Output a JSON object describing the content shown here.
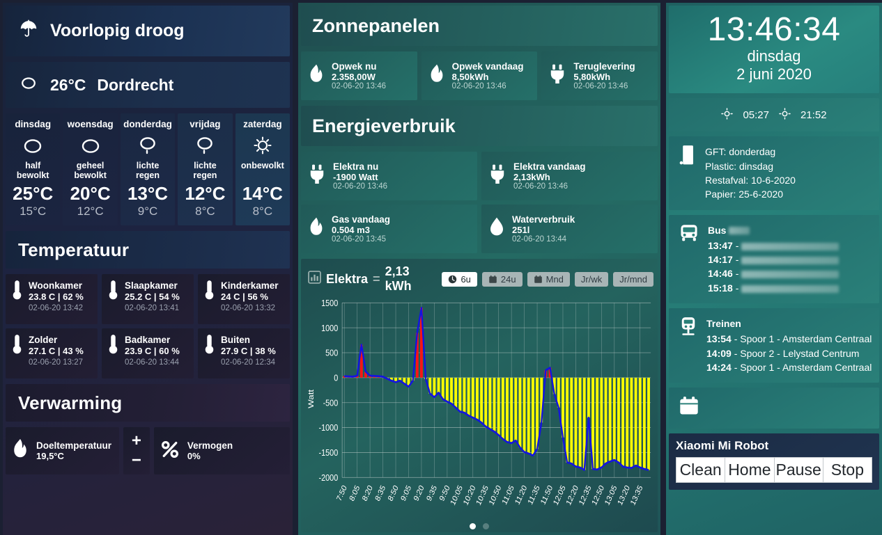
{
  "weather": {
    "forecast_summary": "Voorlopig droog",
    "current_temp": "26°C",
    "location": "Dordrecht",
    "summary_icon": "umbrella-icon",
    "current_icon": "cloud-icon",
    "days": [
      {
        "name": "dinsdag",
        "icon": "cloud-icon",
        "desc": "half\nbewolkt",
        "high": "25°C",
        "low": "15°C"
      },
      {
        "name": "woensdag",
        "icon": "cloud-icon",
        "desc": "geheel\nbewolkt",
        "high": "20°C",
        "low": "12°C"
      },
      {
        "name": "donderdag",
        "icon": "rain-icon",
        "desc": "lichte\nregen",
        "high": "13°C",
        "low": "9°C"
      },
      {
        "name": "vrijdag",
        "icon": "rain-icon",
        "desc": "lichte\nregen",
        "high": "12°C",
        "low": "8°C"
      },
      {
        "name": "zaterdag",
        "icon": "sun-icon",
        "desc": "onbewolkt",
        "high": "14°C",
        "low": "8°C"
      }
    ]
  },
  "temperature": {
    "title": "Temperatuur",
    "sensors": [
      {
        "icon": "thermometer-icon",
        "name": "Woonkamer",
        "value": "23.8 C | 62 %",
        "timestamp": "02-06-20 13:42"
      },
      {
        "icon": "thermometer-icon",
        "name": "Slaapkamer",
        "value": "25.2 C | 54 %",
        "timestamp": "02-06-20 13:41"
      },
      {
        "icon": "thermometer-icon",
        "name": "Kinderkamer",
        "value": "24 C | 56 %",
        "timestamp": "02-06-20 13:32"
      },
      {
        "icon": "thermometer-icon",
        "name": "Zolder",
        "value": "27.1 C | 43 %",
        "timestamp": "02-06-20 13:27"
      },
      {
        "icon": "thermometer-icon",
        "name": "Badkamer",
        "value": "23.9 C | 60 %",
        "timestamp": "02-06-20 13:44"
      },
      {
        "icon": "thermometer-icon",
        "name": "Buiten",
        "value": "27.9 C | 38 %",
        "timestamp": "02-06-20 12:34"
      }
    ]
  },
  "heating": {
    "title": "Verwarming",
    "target": {
      "icon": "flame-icon",
      "name": "Doeltemperatuur",
      "value": "19,5°C"
    },
    "power": {
      "icon": "percent-icon",
      "name": "Vermogen",
      "value": "0%"
    },
    "increase_label": "+",
    "decrease_label": "−"
  },
  "solar": {
    "title": "Zonnepanelen",
    "tiles": [
      {
        "icon": "flame-icon",
        "name": "Opwek nu",
        "value": "2.358,00W",
        "timestamp": "02-06-20 13:46"
      },
      {
        "icon": "flame-icon",
        "name": "Opwek vandaag",
        "value": "8,50kWh",
        "timestamp": "02-06-20 13:46"
      },
      {
        "icon": "plug-icon",
        "name": "Teruglevering",
        "value": "5,80kWh",
        "timestamp": "02-06-20 13:46"
      }
    ]
  },
  "energy": {
    "title": "Energieverbruik",
    "tiles": [
      {
        "icon": "plug-icon",
        "name": "Elektra nu",
        "value": "-1900 Watt",
        "timestamp": "02-06-20 13:46"
      },
      {
        "icon": "plug-icon",
        "name": "Elektra vandaag",
        "value": "2,13kWh",
        "timestamp": "02-06-20 13:46"
      },
      {
        "icon": "flame-icon",
        "name": "Gas vandaag",
        "value": "0.504 m3",
        "timestamp": "02-06-20 13:45"
      },
      {
        "icon": "waterdrop-icon",
        "name": "Waterverbruik",
        "value": "251l",
        "timestamp": "02-06-20 13:44"
      }
    ]
  },
  "chart_header": {
    "icon": "bar-chart-icon",
    "label": "Elektra",
    "separator": "=",
    "value": "2,13 kWh",
    "ranges": [
      {
        "label": "6u",
        "icon": "clock-icon",
        "active": true
      },
      {
        "label": "24u",
        "icon": "calendar-icon",
        "active": false
      },
      {
        "label": "Mnd",
        "icon": "calendar-icon",
        "active": false
      },
      {
        "label": "Jr/wk",
        "icon": "",
        "active": false
      },
      {
        "label": "Jr/mnd",
        "icon": "",
        "active": false
      }
    ]
  },
  "chart_data": {
    "type": "bar",
    "title": "Elektra",
    "xlabel": "",
    "ylabel": "Watt",
    "ylim": [
      -2000,
      1500
    ],
    "yticks": [
      1500,
      1000,
      500,
      0,
      -500,
      -1000,
      -1500,
      -2000
    ],
    "grid": true,
    "legend": "none",
    "colors": {
      "positive_bar": "#ff1414",
      "negative_bar": "#ffff00",
      "line": "#1414e0"
    },
    "xtick_labels": [
      "7:50",
      "8:05",
      "8:20",
      "8:35",
      "8:50",
      "9:05",
      "9:20",
      "9:35",
      "9:50",
      "10:05",
      "10:20",
      "10:35",
      "10:50",
      "11:05",
      "11:20",
      "11:35",
      "11:50",
      "12:05",
      "12:20",
      "12:35",
      "12:50",
      "13:05",
      "13:20",
      "13:35"
    ],
    "x": [
      "7:50",
      "7:55",
      "8:00",
      "8:05",
      "8:10",
      "8:15",
      "8:20",
      "8:25",
      "8:30",
      "8:35",
      "8:40",
      "8:45",
      "8:50",
      "8:55",
      "9:00",
      "9:05",
      "9:10",
      "9:15",
      "9:20",
      "9:25",
      "9:30",
      "9:35",
      "9:40",
      "9:45",
      "9:50",
      "9:55",
      "10:00",
      "10:05",
      "10:10",
      "10:15",
      "10:20",
      "10:25",
      "10:30",
      "10:35",
      "10:40",
      "10:45",
      "10:50",
      "10:55",
      "11:00",
      "11:05",
      "11:10",
      "11:15",
      "11:20",
      "11:25",
      "11:30",
      "11:35",
      "11:40",
      "11:45",
      "11:50",
      "11:55",
      "12:00",
      "12:05",
      "12:10",
      "12:15",
      "12:20",
      "12:25",
      "12:30",
      "12:35",
      "12:40",
      "12:45",
      "12:50",
      "12:55",
      "13:00",
      "13:05",
      "13:10",
      "13:15",
      "13:20",
      "13:25",
      "13:30",
      "13:35",
      "13:40",
      "13:45"
    ],
    "series": [
      {
        "name": "Elektra",
        "unit": "Watt",
        "values": [
          30,
          25,
          20,
          40,
          660,
          120,
          40,
          35,
          30,
          20,
          -20,
          -60,
          -90,
          -60,
          -120,
          -180,
          -60,
          900,
          1400,
          -30,
          -320,
          -390,
          -300,
          -430,
          -480,
          -520,
          -600,
          -680,
          -700,
          -760,
          -800,
          -840,
          -900,
          -980,
          -1030,
          -1080,
          -1150,
          -1230,
          -1290,
          -1310,
          -1260,
          -1400,
          -1490,
          -1520,
          -1560,
          -1430,
          -900,
          150,
          200,
          -330,
          -600,
          -1200,
          -1700,
          -1720,
          -1780,
          -1800,
          -1850,
          -800,
          -1830,
          -1840,
          -1800,
          -1720,
          -1680,
          -1650,
          -1700,
          -1780,
          -1800,
          -1810,
          -1760,
          -1800,
          -1830,
          -1850
        ]
      }
    ]
  },
  "pagination": {
    "total": 2,
    "active": 1
  },
  "clock": {
    "time": "13:46:34",
    "day": "dinsdag",
    "date": "2 juni 2020"
  },
  "sun": {
    "sunrise_icon": "sunrise-icon",
    "sunrise": "05:27",
    "sunset_icon": "sunset-icon",
    "sunset": "21:52"
  },
  "waste": {
    "icon": "trash-icon",
    "lines": [
      "GFT: donderdag",
      "Plastic: dinsdag",
      "Restafval: 10-6-2020",
      "Papier: 25-6-2020"
    ]
  },
  "bus": {
    "icon": "bus-icon",
    "title": "Bus",
    "departures": [
      {
        "time": "13:47",
        "destination": ""
      },
      {
        "time": "14:17",
        "destination": ""
      },
      {
        "time": "14:46",
        "destination": ""
      },
      {
        "time": "15:18",
        "destination": ""
      }
    ]
  },
  "trains": {
    "icon": "train-icon",
    "title": "Treinen",
    "departures": [
      {
        "time": "13:54",
        "info": "- Spoor 1 - Amsterdam Centraal"
      },
      {
        "time": "14:09",
        "info": "- Spoor 2 - Lelystad Centrum"
      },
      {
        "time": "14:24",
        "info": "- Spoor 1 - Amsterdam Centraal"
      }
    ]
  },
  "calendar": {
    "icon": "calendar-icon"
  },
  "robot": {
    "title": "Xiaomi Mi Robot",
    "buttons": [
      "Clean",
      "Home",
      "Pause",
      "Stop"
    ]
  }
}
